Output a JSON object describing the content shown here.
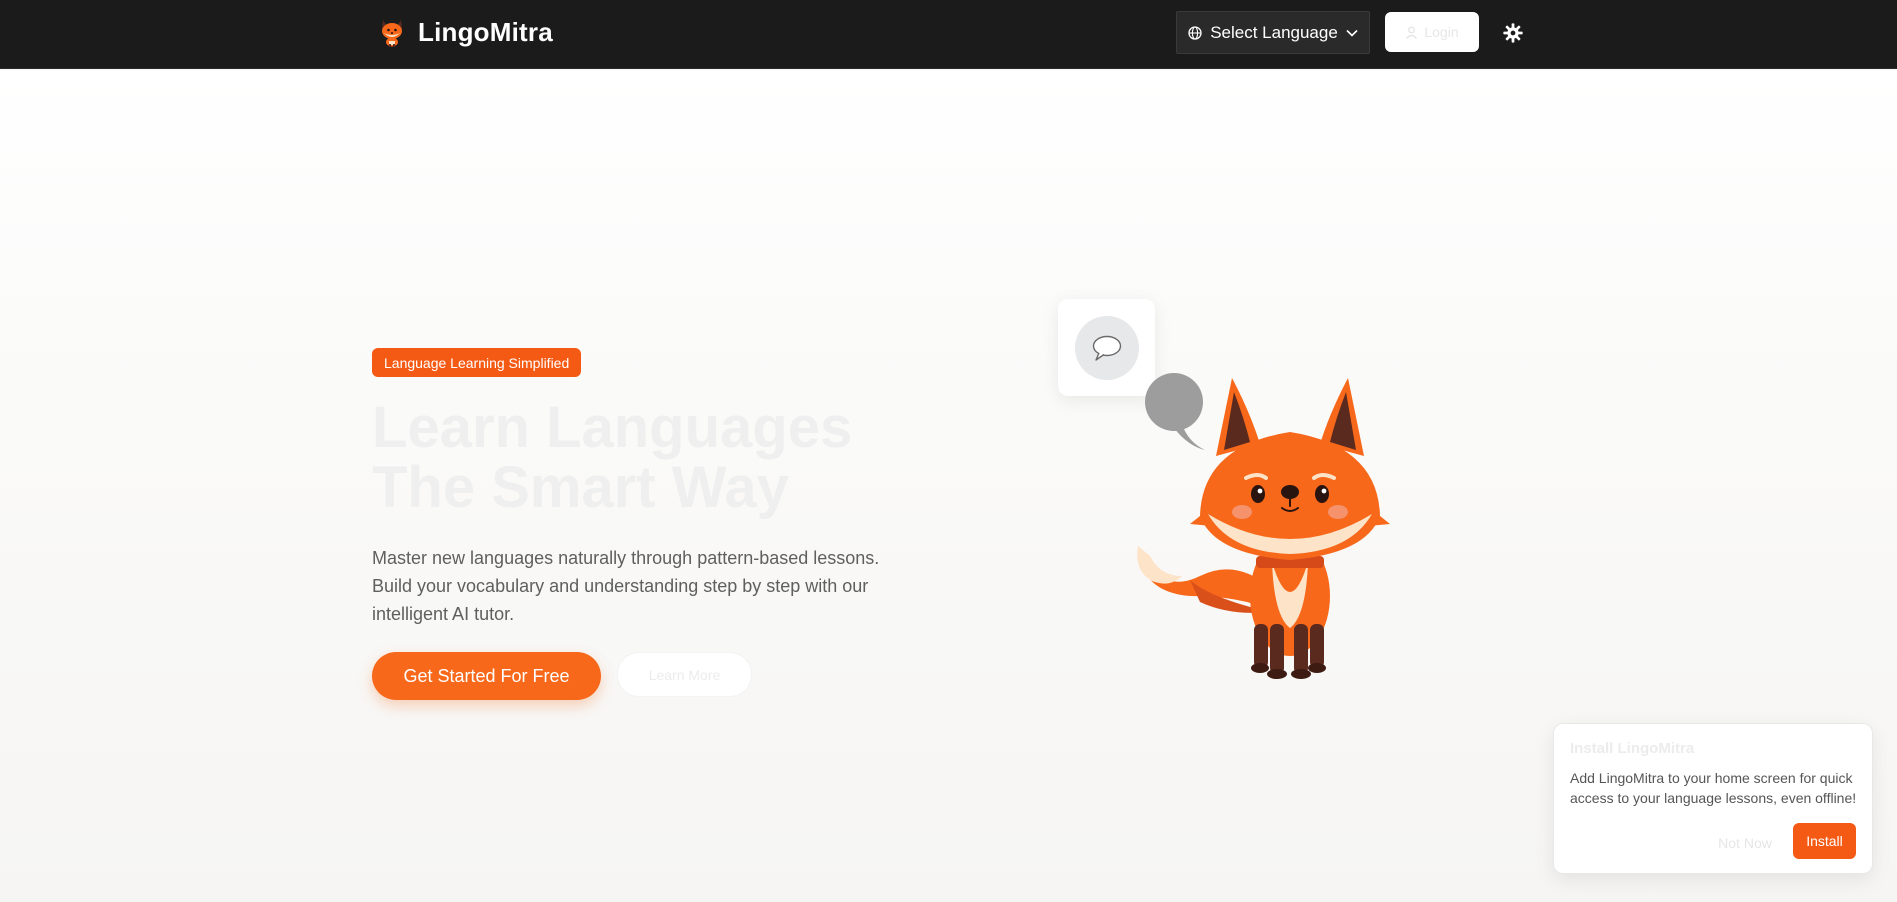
{
  "brand": {
    "name": "LingoMitra",
    "logo_icon": "fox-logo-icon"
  },
  "navbar": {
    "language_select": {
      "label": "Select Language",
      "icon": "globe-icon",
      "chevron": "chevron-down-icon"
    },
    "login": {
      "label": "Login",
      "icon": "user-icon"
    },
    "theme_toggle": {
      "icon": "gear-icon"
    }
  },
  "hero": {
    "tag": "Language Learning Simplified",
    "headline_line1": "Learn Languages",
    "headline_line2": "The Smart Way",
    "lead": "Master new languages naturally through pattern-based lessons. Build your vocabulary and understanding step by step with our intelligent AI tutor.",
    "cta_primary": "Get Started For Free",
    "cta_secondary": "Learn More"
  },
  "illustration": {
    "chat_icon": "chat-bubble-icon",
    "mascot": "fox-mascot"
  },
  "install_prompt": {
    "title": "Install LingoMitra",
    "description": "Add LingoMitra to your home screen for quick access to your language lessons, even offline!",
    "dismiss_label": "Not Now",
    "install_label": "Install"
  },
  "colors": {
    "navbar_bg": "#1b1b1b",
    "accent": "#f55a14",
    "cta": "#f7681a",
    "text_muted": "#5f5f5f"
  }
}
